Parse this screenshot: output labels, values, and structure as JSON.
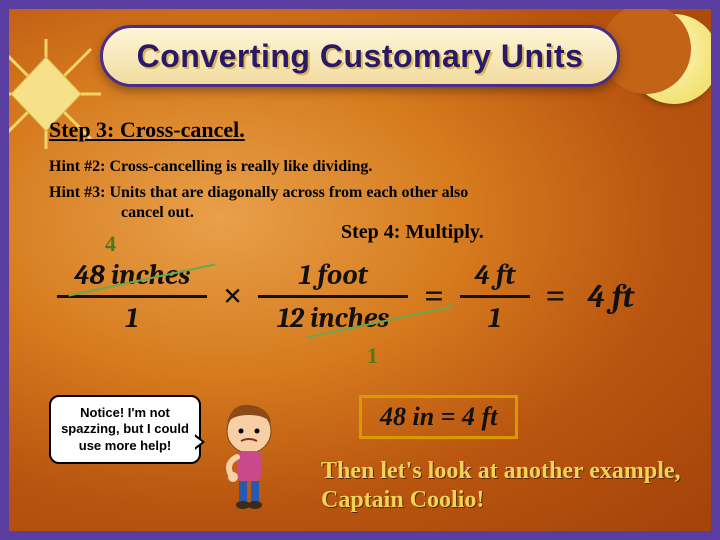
{
  "banner": {
    "title": "Converting Customary Units"
  },
  "step3": "Step 3: Cross-cancel.",
  "hint2": "Hint #2: Cross-cancelling is really like dividing.",
  "hint3a": "Hint #3: Units that are diagonally across from each other also",
  "hint3b": "cancel out.",
  "step4": "Step 4: Multiply.",
  "green4": "4",
  "green1": "1",
  "frac1": {
    "num": "48 inches",
    "den": "1"
  },
  "op_times": "×",
  "frac2": {
    "num": "1 foot",
    "den": "12 inches"
  },
  "op_eq1": "=",
  "frac3": {
    "num": "4 ft",
    "den": "1"
  },
  "op_eq2": "=",
  "answer": "4 ft",
  "bubble": "Notice! I'm not spazzing, but I could use more help!",
  "result": "48 in = 4 ft",
  "closing": "Then let's look at another example, Captain Coolio!"
}
